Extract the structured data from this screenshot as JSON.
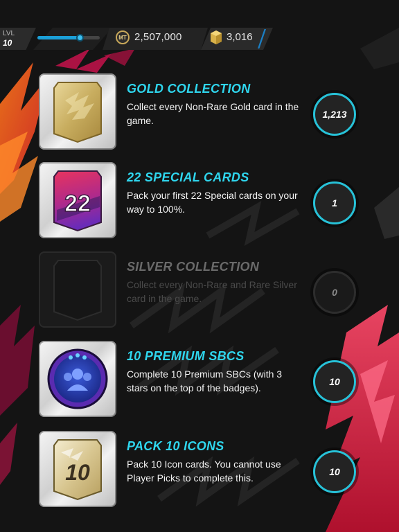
{
  "header": {
    "level_label": "LVL",
    "level_value": "10",
    "xp_progress": 0.68,
    "coins_icon_text": "MT",
    "coins": "2,507,000",
    "points": "3,016"
  },
  "colors": {
    "accent": "#2fd6ee",
    "ring": "#27c2d8",
    "xp": "#1ba0d8",
    "background": "#141414"
  },
  "objectives": [
    {
      "title": "GOLD COLLECTION",
      "description": "Collect every Non-Rare Gold card in the game.",
      "count": "1,213",
      "icon": "gold-card-icon",
      "enabled": true
    },
    {
      "title": "22 SPECIAL CARDS",
      "description": "Pack your first 22 Special cards on your way to 100%.",
      "count": "1",
      "icon": "special-card-22-icon",
      "badge_text": "22",
      "enabled": true
    },
    {
      "title": "SILVER COLLECTION",
      "description": "Collect every Non-Rare and Rare Silver card in the game.",
      "count": "0",
      "icon": "silver-card-outline-icon",
      "enabled": false
    },
    {
      "title": "10 PREMIUM SBCS",
      "description": "Complete 10 Premium SBCs (with 3 stars on the top of the badges).",
      "count": "10",
      "icon": "premium-sbc-badge-icon",
      "enabled": true
    },
    {
      "title": "PACK 10 ICONS",
      "description": "Pack 10 Icon cards. You cannot use Player Picks to complete this.",
      "count": "10",
      "icon": "icon-card-10-icon",
      "badge_text": "10",
      "enabled": true
    }
  ]
}
